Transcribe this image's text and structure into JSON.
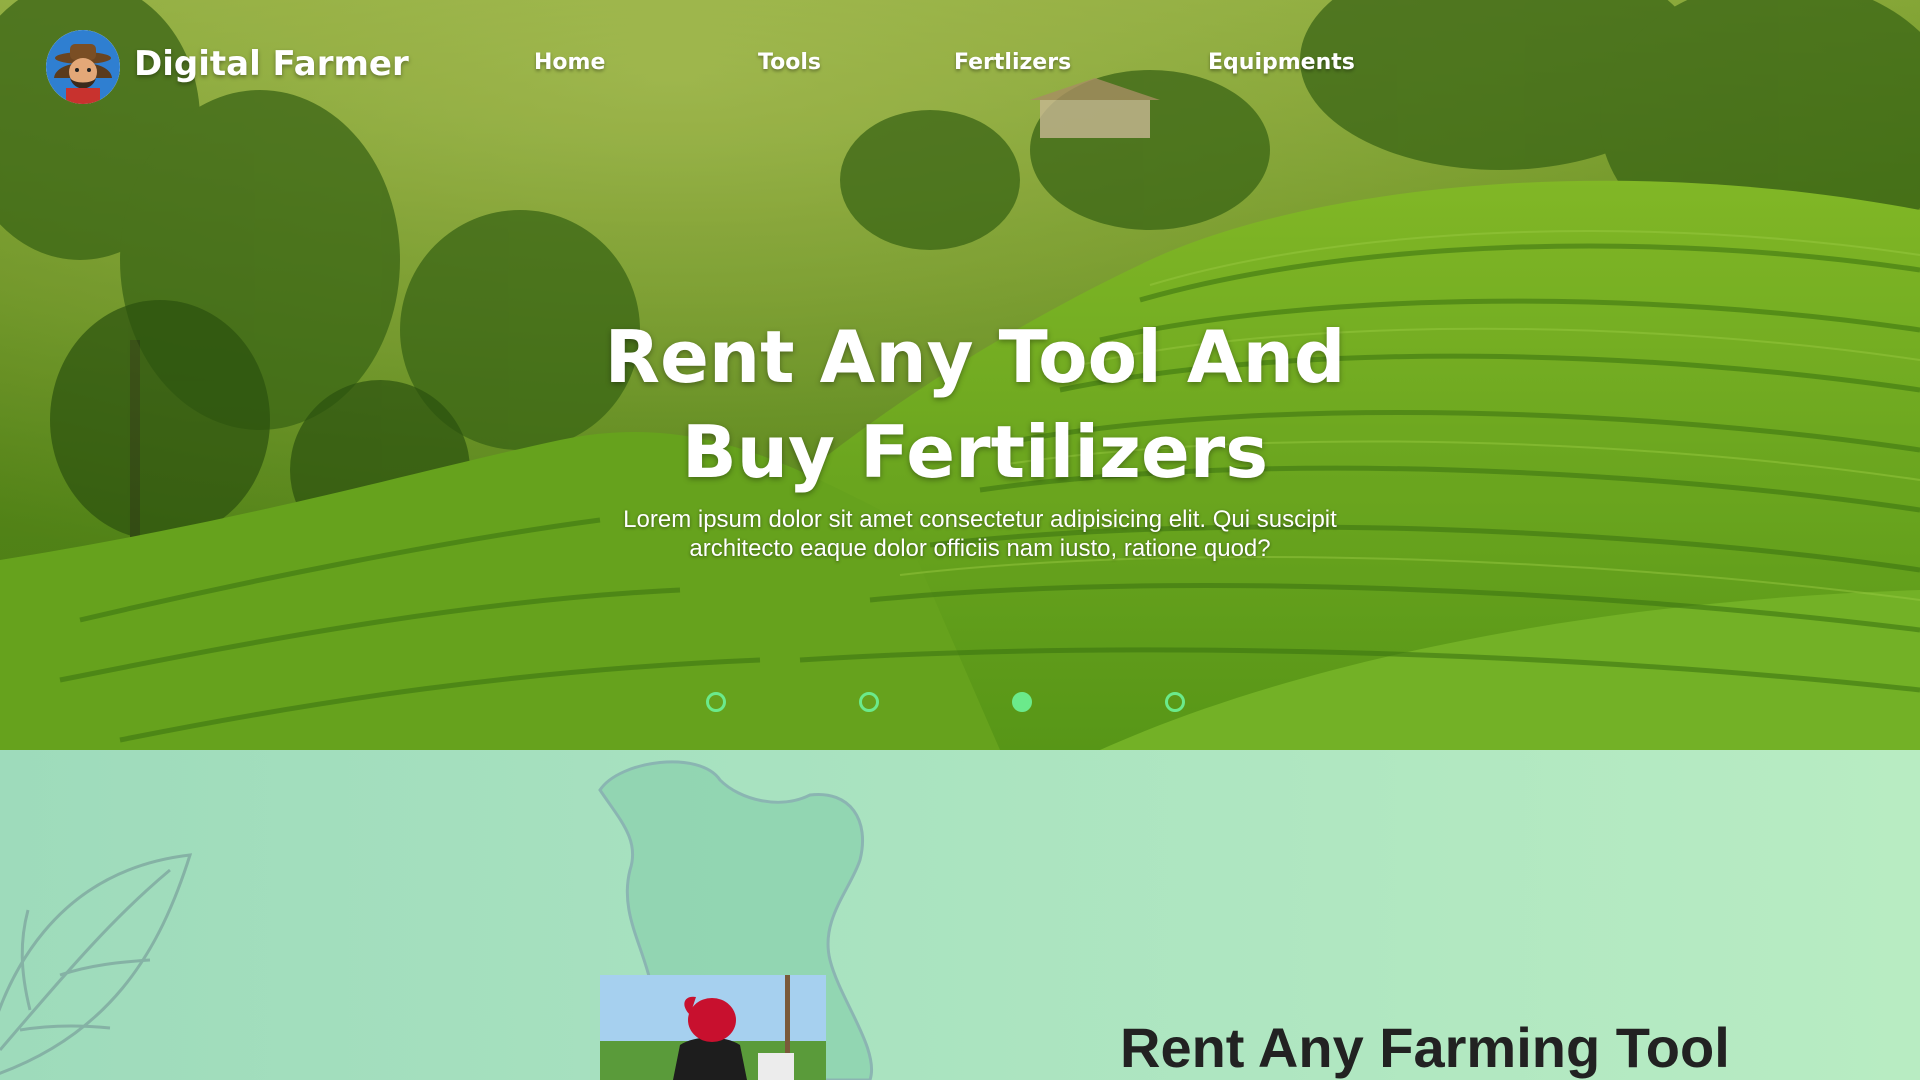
{
  "brand": {
    "name": "Digital Farmer"
  },
  "nav": {
    "items": [
      {
        "label": "Home"
      },
      {
        "label": "Tools"
      },
      {
        "label": "Fertlizers"
      },
      {
        "label": "Equipments"
      }
    ]
  },
  "hero": {
    "headline_line1": "Rent Any Tool And",
    "headline_line2": "Buy Fertilizers",
    "subtitle": "Lorem ipsum dolor sit amet consectetur adipisicing elit. Qui suscipit architecto eaque dolor officiis nam iusto, ratione quod?",
    "carousel": {
      "slides": 4,
      "active_index": 2
    }
  },
  "section": {
    "title": "Rent Any Farming Tool"
  },
  "colors": {
    "accent": "#6bea8b",
    "section_bg": "#a8e2c0",
    "title_text": "#222222"
  },
  "icons": {
    "logo": "farmer-avatar-icon"
  }
}
